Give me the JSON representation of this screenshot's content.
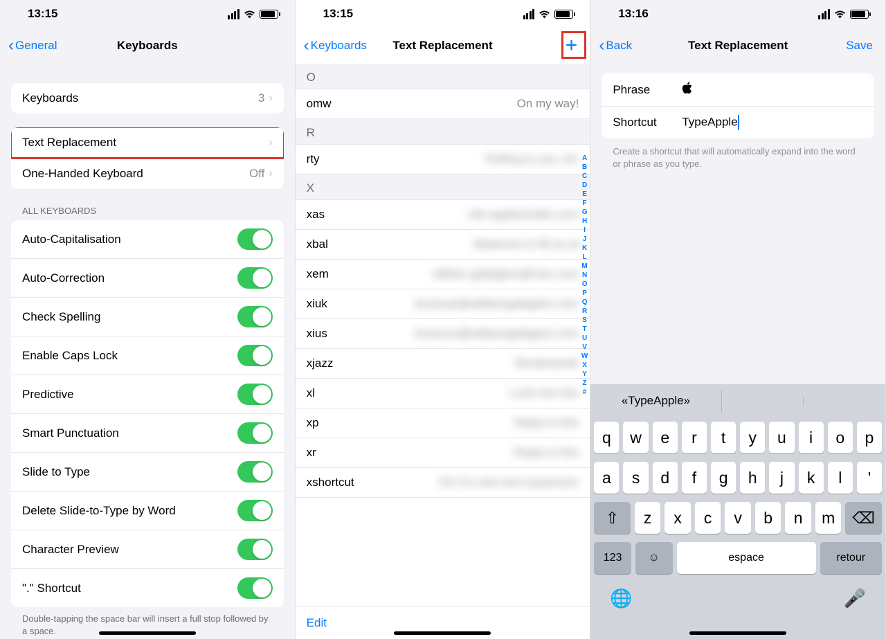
{
  "panel1": {
    "time": "13:15",
    "back": "General",
    "title": "Keyboards",
    "rows": {
      "keyboards_label": "Keyboards",
      "keyboards_count": "3",
      "text_replacement": "Text Replacement",
      "one_handed": "One-Handed Keyboard",
      "one_handed_val": "Off"
    },
    "section_all": "ALL KEYBOARDS",
    "toggles": [
      "Auto-Capitalisation",
      "Auto-Correction",
      "Check Spelling",
      "Enable Caps Lock",
      "Predictive",
      "Smart Punctuation",
      "Slide to Type",
      "Delete Slide-to-Type by Word",
      "Character Preview",
      "\".\" Shortcut"
    ],
    "footer": "Double-tapping the space bar will insert a full stop followed by a space."
  },
  "panel2": {
    "time": "13:15",
    "back": "Keyboards",
    "title": "Text Replacement",
    "sections": [
      {
        "letter": "O",
        "items": [
          {
            "shortcut": "omw",
            "phrase": "On my way!",
            "blur": false
          }
        ]
      },
      {
        "letter": "R",
        "items": [
          {
            "shortcut": "rty",
            "phrase": "Rolling to you, thx",
            "blur": true
          }
        ]
      },
      {
        "letter": "X",
        "items": [
          {
            "shortcut": "xas",
            "phrase": "info.appleinsider.com",
            "blur": true
          },
          {
            "shortcut": "xbal",
            "phrase": "Balances to fill as at",
            "blur": true
          },
          {
            "shortcut": "xem",
            "phrase": "william.gallagher@mac.com",
            "blur": true
          },
          {
            "shortcut": "xiuk",
            "phrase": "itunesuk@williamgallagher.com",
            "blur": true
          },
          {
            "shortcut": "xius",
            "phrase": "itunesus@williamgallagher.com",
            "blur": true
          },
          {
            "shortcut": "xjazz",
            "phrase": "Borderlands",
            "blur": true
          },
          {
            "shortcut": "xl",
            "phrase": "Look into this",
            "blur": true
          },
          {
            "shortcut": "xp",
            "phrase": "Reply to this",
            "blur": true
          },
          {
            "shortcut": "xr",
            "phrase": "Reply to this",
            "blur": true
          },
          {
            "shortcut": "xshortcut",
            "phrase": "OS X's own text expansion",
            "blur": true
          }
        ]
      }
    ],
    "index": [
      "A",
      "B",
      "C",
      "D",
      "E",
      "F",
      "G",
      "H",
      "I",
      "J",
      "K",
      "L",
      "M",
      "N",
      "O",
      "P",
      "Q",
      "R",
      "S",
      "T",
      "U",
      "V",
      "W",
      "X",
      "Y",
      "Z",
      "#"
    ],
    "edit": "Edit"
  },
  "panel3": {
    "time": "13:16",
    "back": "Back",
    "title": "Text Replacement",
    "save": "Save",
    "phrase_label": "Phrase",
    "phrase_value": "",
    "shortcut_label": "Shortcut",
    "shortcut_value": "TypeApple",
    "hint": "Create a shortcut that will automatically expand into the word or phrase as you type.",
    "suggest": "«TypeApple»",
    "row1": [
      "q",
      "w",
      "e",
      "r",
      "t",
      "y",
      "u",
      "i",
      "o",
      "p"
    ],
    "row2": [
      "a",
      "s",
      "d",
      "f",
      "g",
      "h",
      "j",
      "k",
      "l",
      "'"
    ],
    "row3": [
      "z",
      "x",
      "c",
      "v",
      "b",
      "n",
      "m"
    ],
    "k123": "123",
    "kspace": "espace",
    "kreturn": "retour"
  }
}
